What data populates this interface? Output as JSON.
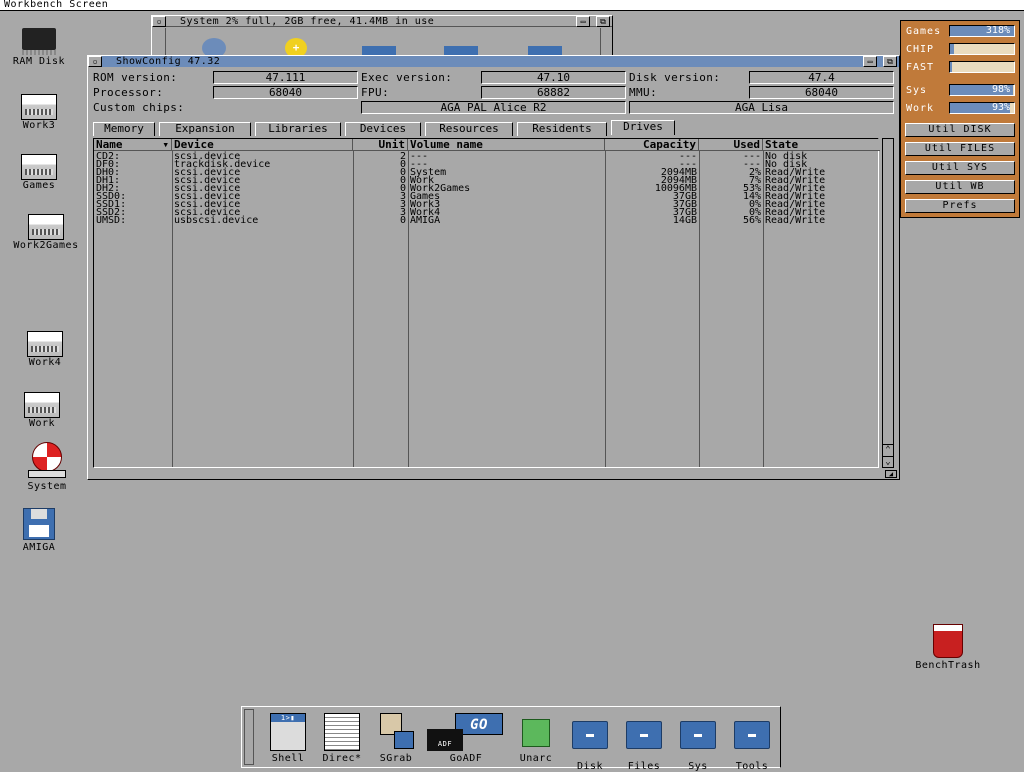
{
  "screen": {
    "title": "Workbench Screen"
  },
  "system_window": {
    "title": "System  2% full, 2GB free, 41.4MB in use"
  },
  "desktop_icons": [
    {
      "label": "RAM Disk",
      "icon": "ram-chip-icon"
    },
    {
      "label": "Work3",
      "icon": "harddrive-icon"
    },
    {
      "label": "Games",
      "icon": "harddrive-icon"
    },
    {
      "label": "Work2Games",
      "icon": "harddrive-icon"
    },
    {
      "label": "Work4",
      "icon": "harddrive-icon"
    },
    {
      "label": "Work",
      "icon": "harddrive-icon"
    },
    {
      "label": "System",
      "icon": "boing-ball-icon"
    },
    {
      "label": "AMIGA",
      "icon": "floppy-icon"
    },
    {
      "label": "BenchTrash",
      "icon": "trash-icon"
    }
  ],
  "showconfig": {
    "title": "ShowConfig 47.32",
    "rom_label": "ROM version:",
    "rom_value": "47.111",
    "exec_label": "Exec version:",
    "exec_value": "47.10",
    "disk_label": "Disk version:",
    "disk_value": "47.4",
    "proc_label": "Processor:",
    "proc_value": "68040",
    "fpu_label": "FPU:",
    "fpu_value": "68882",
    "mmu_label": "MMU:",
    "mmu_value": "68040",
    "chips_label": "Custom chips:",
    "chips_value1": "AGA PAL Alice R2",
    "chips_value2": "AGA Lisa",
    "tabs": [
      "Memory",
      "Expansion",
      "Libraries",
      "Devices",
      "Resources",
      "Residents",
      "Drives"
    ],
    "active_tab": "Drives",
    "columns": [
      "Name",
      "Device",
      "Unit",
      "Volume name",
      "Capacity",
      "Used",
      "State"
    ],
    "rows": [
      [
        "CD2:",
        "scsi.device",
        "2",
        "---",
        "---",
        "---",
        "No disk"
      ],
      [
        "DF0:",
        "trackdisk.device",
        "0",
        "---",
        "---",
        "---",
        "No disk"
      ],
      [
        "DH0:",
        "scsi.device",
        "0",
        "System",
        "2094MB",
        "2%",
        "Read/Write"
      ],
      [
        "DH1:",
        "scsi.device",
        "0",
        "Work",
        "2094MB",
        "7%",
        "Read/Write"
      ],
      [
        "DH2:",
        "scsi.device",
        "0",
        "Work2Games",
        "10096MB",
        "53%",
        "Read/Write"
      ],
      [
        "SSD0:",
        "scsi.device",
        "3",
        "Games",
        "37GB",
        "14%",
        "Read/Write"
      ],
      [
        "SSD1:",
        "scsi.device",
        "3",
        "Work3",
        "37GB",
        "0%",
        "Read/Write"
      ],
      [
        "SSD2:",
        "scsi.device",
        "3",
        "Work4",
        "37GB",
        "0%",
        "Read/Write"
      ],
      [
        "UMSD:",
        "usbscsi.device",
        "0",
        "AMIGA",
        "14GB",
        "56%",
        "Read/Write"
      ]
    ]
  },
  "panel": {
    "bars": [
      {
        "label": "Games",
        "text": "318%",
        "fill": 1.0
      },
      {
        "label": "CHIP",
        "text": "",
        "fill": 0.06
      },
      {
        "label": "FAST",
        "text": "",
        "fill": 0.03
      },
      {
        "label": "Sys",
        "text": "98%",
        "fill": 0.98
      },
      {
        "label": "Work",
        "text": "93%",
        "fill": 0.93
      }
    ],
    "buttons": [
      "Util DISK",
      "Util FILES",
      "Util SYS",
      "Util WB",
      "Prefs"
    ],
    "colors": {
      "panel": "#c07a3a",
      "fill": "#6c8cba"
    }
  },
  "dock": {
    "items": [
      {
        "label": "Shell",
        "icon": "shell-icon"
      },
      {
        "label": "Direc*",
        "icon": "directory-opus-icon"
      },
      {
        "label": "SGrab",
        "icon": "screengrab-icon"
      },
      {
        "label": "GoADF",
        "icon": "goadf-icon"
      },
      {
        "label": "Unarc",
        "icon": "unarc-cube-icon"
      },
      {
        "label": "Disk",
        "icon": "drawer-icon"
      },
      {
        "label": "Files",
        "icon": "drawer-icon"
      },
      {
        "label": "Sys",
        "icon": "drawer-icon"
      },
      {
        "label": "Tools",
        "icon": "drawer-icon"
      }
    ]
  }
}
